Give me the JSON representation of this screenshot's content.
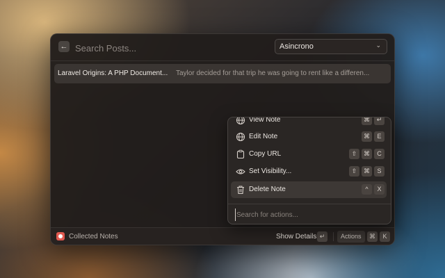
{
  "header": {
    "search_placeholder": "Search Posts...",
    "dropdown_value": "Asincrono"
  },
  "results": [
    {
      "title": "Laravel Origins: A PHP Document...",
      "description": "Taylor decided for that trip he was going to rent like a differen..."
    }
  ],
  "footer": {
    "app_name": "Collected Notes",
    "primary_action": "Show Details",
    "primary_shortcut": "↵",
    "actions_label": "Actions",
    "actions_shortcut": [
      "⌘",
      "K"
    ]
  },
  "actions_menu": {
    "items": [
      {
        "label": "View Note",
        "icon": "globe-icon",
        "shortcut": [
          "⌘",
          "↵"
        ]
      },
      {
        "label": "Edit Note",
        "icon": "globe-icon",
        "shortcut": [
          "⌘",
          "E"
        ]
      },
      {
        "label": "Copy URL",
        "icon": "clipboard-icon",
        "shortcut": [
          "⇧",
          "⌘",
          "C"
        ]
      },
      {
        "label": "Set Visibility...",
        "icon": "eye-icon",
        "shortcut": [
          "⇧",
          "⌘",
          "S"
        ]
      },
      {
        "label": "Delete Note",
        "icon": "trash-icon",
        "shortcut": [
          "^",
          "X"
        ]
      }
    ],
    "selected_index": 4,
    "search_placeholder": "Search for actions..."
  },
  "colors": {
    "app_icon": "#e0584f",
    "panel_bg": "#211d1b",
    "selected_row": "#3a3532"
  }
}
